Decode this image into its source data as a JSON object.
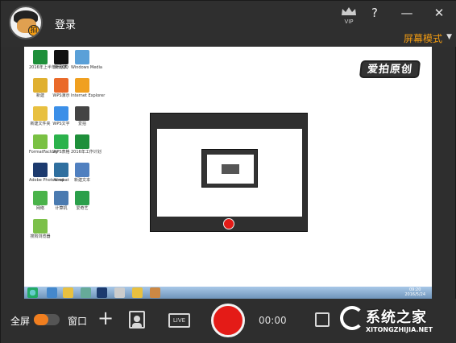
{
  "titlebar": {
    "login_label": "登录",
    "vip_label": "VIP",
    "help_label": "?",
    "minimize_label": "—",
    "close_label": "✕",
    "mode_label": "屏幕模式",
    "mode_caret": "▼"
  },
  "preview": {
    "logo_text": "爱拍原创",
    "icons": [
      {
        "label": "2016年上半年计划表",
        "color": "#1e8f3a"
      },
      {
        "label": "腾讯QQ",
        "color": "#111111"
      },
      {
        "label": "Windows Media",
        "color": "#5aa0d8"
      },
      {
        "label": "新建",
        "color": "#e0b030"
      },
      {
        "label": "WPS演示",
        "color": "#ea6a2a"
      },
      {
        "label": "Internet Explorer",
        "color": "#f0a020"
      },
      {
        "label": "新建文件夹",
        "color": "#e8c040"
      },
      {
        "label": "WPS文字",
        "color": "#3b8fe8"
      },
      {
        "label": "爱拍",
        "color": "#444444"
      },
      {
        "label": "FormatFactory",
        "color": "#7ac143"
      },
      {
        "label": "WPS表格",
        "color": "#2bb24c"
      },
      {
        "label": "2016年工作计划",
        "color": "#1e8f3a"
      },
      {
        "label": "Adobe Photoshop",
        "color": "#1c3a6e"
      },
      {
        "label": "Acrobat",
        "color": "#2f6f9f"
      },
      {
        "label": "新建文本",
        "color": "#5080c0"
      },
      {
        "label": "网络",
        "color": "#4ab34a"
      },
      {
        "label": "计算机",
        "color": "#4a7ab0"
      },
      {
        "label": "爱奇艺",
        "color": "#2a9f4a"
      },
      {
        "label": "搜狗浏览器",
        "color": "#7cc04a"
      }
    ],
    "clock": "09:20\n2016/5/24"
  },
  "bottombar": {
    "fullscreen_label": "全屏",
    "window_label": "窗口",
    "add_label": "+",
    "live_label": "LIVE",
    "timer": "00:00"
  },
  "watermark": {
    "brand": "系统之家",
    "url": "XITONGZHIJIA.NET"
  }
}
